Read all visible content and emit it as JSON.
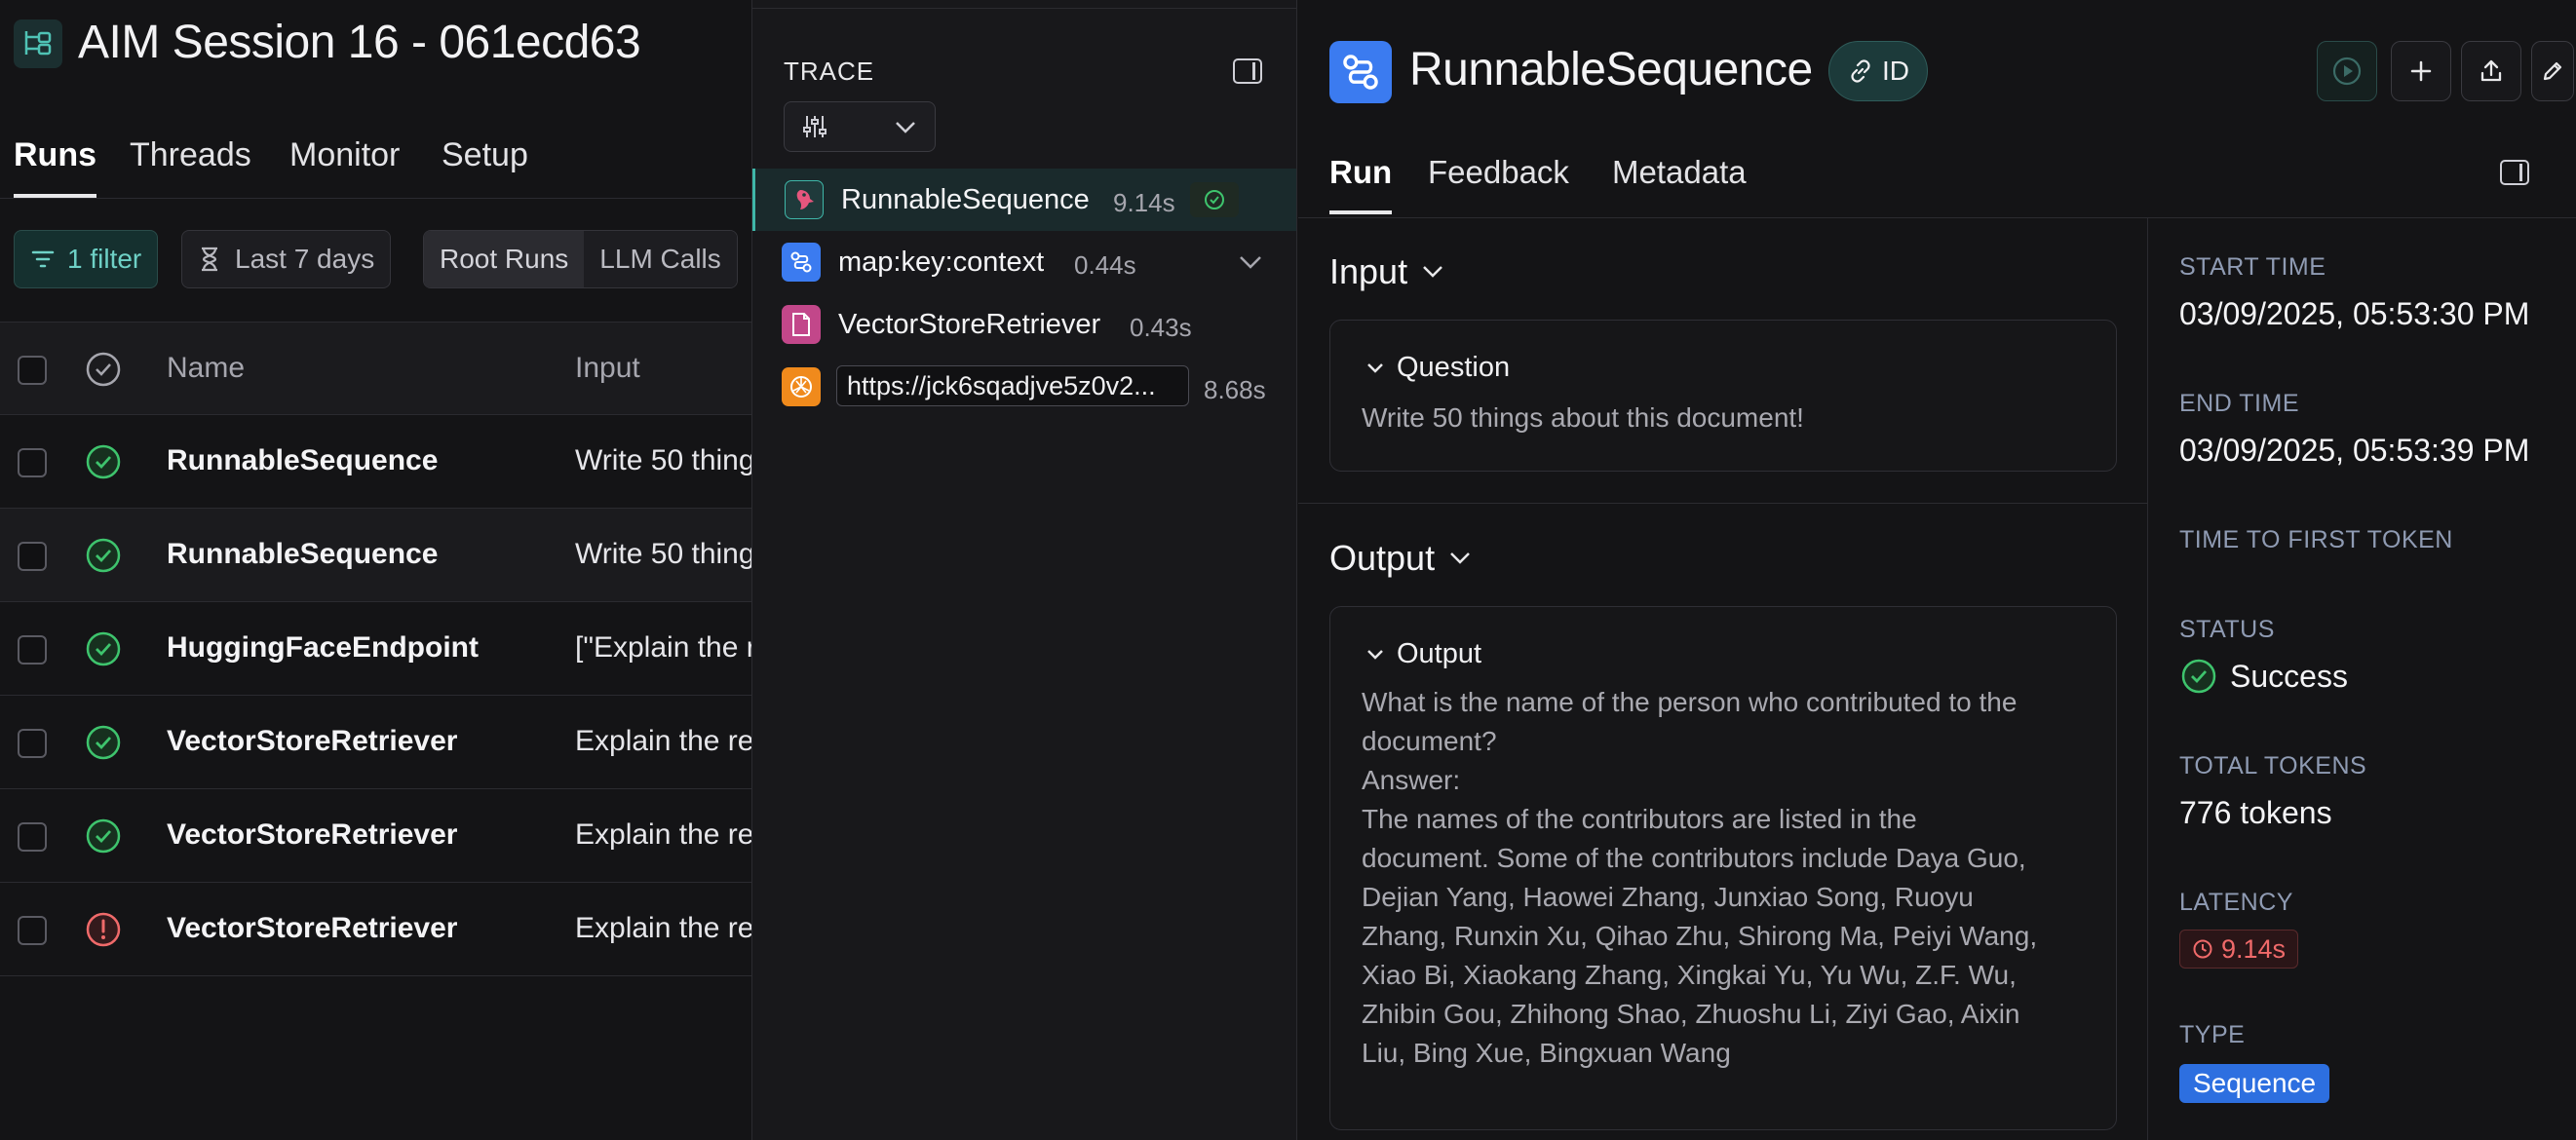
{
  "project": {
    "title": "AIM Session 16 - 061ecd63",
    "tabs": [
      "Runs",
      "Threads",
      "Monitor",
      "Setup"
    ],
    "active_tab": "Runs"
  },
  "filters": {
    "filter_chip": "1 filter",
    "date_chip": "Last 7 days",
    "segments": [
      "Root Runs",
      "LLM Calls"
    ]
  },
  "runs_table": {
    "columns": {
      "name": "Name",
      "input": "Input"
    },
    "rows": [
      {
        "status": "success",
        "name": "RunnableSequence",
        "input": "Write 50 thing"
      },
      {
        "status": "success",
        "name": "RunnableSequence",
        "input": "Write 50 thing"
      },
      {
        "status": "success",
        "name": "HuggingFaceEndpoint",
        "input": "[\"Explain the r"
      },
      {
        "status": "success",
        "name": "VectorStoreRetriever",
        "input": "Explain the re"
      },
      {
        "status": "success",
        "name": "VectorStoreRetriever",
        "input": "Explain the re"
      },
      {
        "status": "error",
        "name": "VectorStoreRetriever",
        "input": "Explain the re"
      }
    ]
  },
  "trace": {
    "label": "TRACE",
    "items": [
      {
        "name": "RunnableSequence",
        "latency": "9.14s",
        "icon": "parrot-icon",
        "color": "#1f3a3b"
      },
      {
        "name": "map:key:context",
        "latency": "0.44s",
        "icon": "flow-icon",
        "color": "#3b7bf0"
      },
      {
        "name": "VectorStoreRetriever",
        "latency": "0.43s",
        "icon": "document-icon",
        "color": "#c2478a"
      },
      {
        "name": "https://jck6sqadjve5z0v2...",
        "latency": "8.68s",
        "icon": "openai-icon",
        "color": "#f08a1c"
      }
    ]
  },
  "run": {
    "title": "RunnableSequence",
    "id_label": "ID",
    "tabs": [
      "Run",
      "Feedback",
      "Metadata"
    ],
    "active_tab": "Run",
    "input": {
      "section_title": "Input",
      "card_title": "Question",
      "text": "Write 50 things about this document!"
    },
    "output": {
      "section_title": "Output",
      "card_title": "Output",
      "text": "What is the name of the person who contributed to the\ndocument?\nAnswer:\nThe names of the contributors are listed in the\ndocument. Some of the contributors include Daya Guo,\nDejian Yang, Haowei Zhang, Junxiao Song, Ruoyu\nZhang, Runxin Xu, Qihao Zhu, Shirong Ma, Peiyi Wang,\nXiao Bi, Xiaokang Zhang, Xingkai Yu, Yu Wu, Z.F. Wu,\nZhibin Gou, Zhihong Shao, Zhuoshu Li, Ziyi Gao, Aixin\nLiu, Bing Xue, Bingxuan Wang"
    },
    "meta": {
      "start_time_label": "START TIME",
      "start_time": "03/09/2025, 05:53:30 PM",
      "end_time_label": "END TIME",
      "end_time": "03/09/2025, 05:53:39 PM",
      "ttft_label": "TIME TO FIRST TOKEN",
      "status_label": "STATUS",
      "status": "Success",
      "tokens_label": "TOTAL TOKENS",
      "tokens": "776 tokens",
      "latency_label": "LATENCY",
      "latency": "9.14s",
      "type_label": "TYPE",
      "type": "Sequence"
    }
  },
  "colors": {
    "accent_teal": "#3fb7a9",
    "success_green": "#3ec46d",
    "error_red": "#f06a6a",
    "brand_blue": "#3b7bf0"
  }
}
